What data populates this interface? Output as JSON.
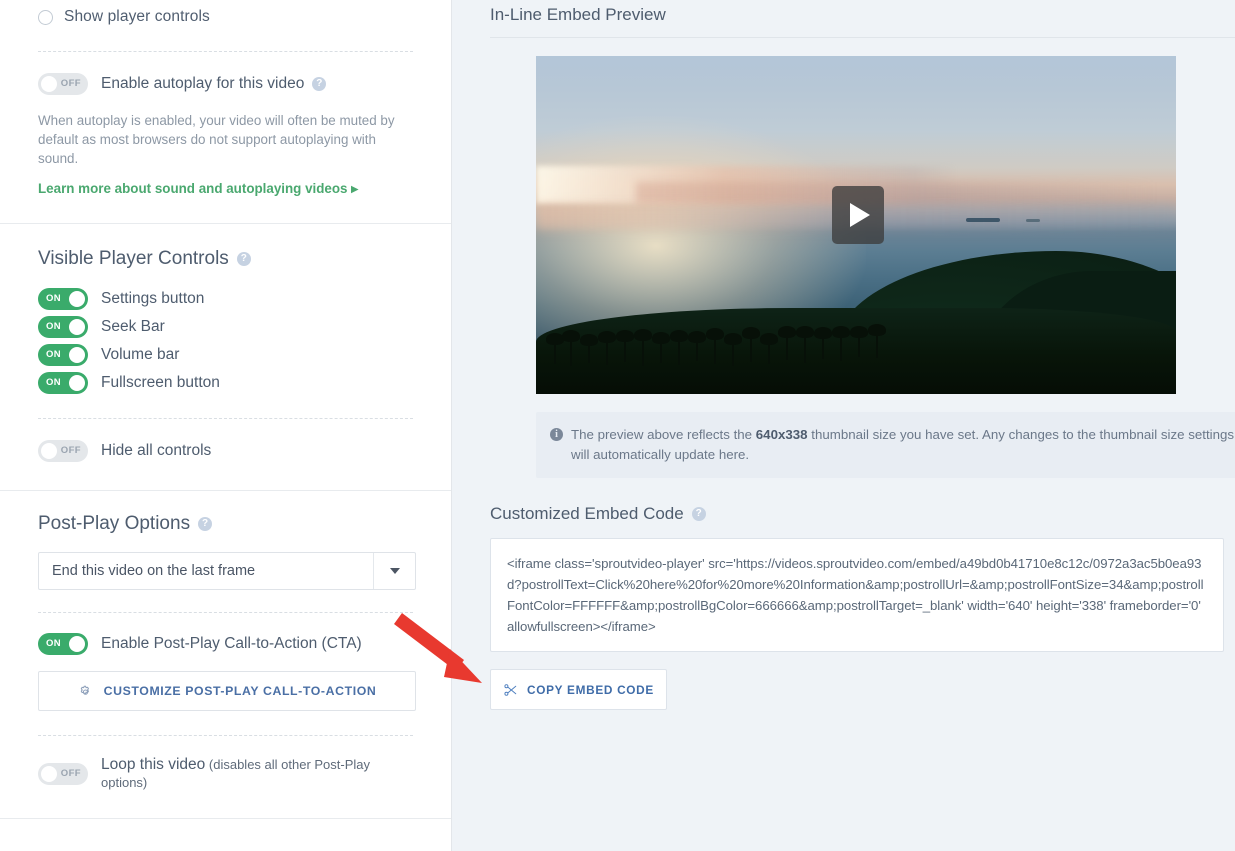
{
  "left_panel": {
    "show_player_controls": {
      "label": "Show player controls",
      "selected": false
    },
    "autoplay": {
      "toggle_state": "OFF",
      "label": "Enable autoplay for this video",
      "help_icon": "question-mark-icon",
      "description": "When autoplay is enabled, your video will often be muted by default as most browsers do not support autoplaying with sound.",
      "learn_more_link": "Learn more about sound and autoplaying videos ▸"
    },
    "visible_player_controls": {
      "title": "Visible Player Controls",
      "help_icon": "question-mark-icon",
      "toggles": [
        {
          "state": "ON",
          "label": "Settings button"
        },
        {
          "state": "ON",
          "label": "Seek Bar"
        },
        {
          "state": "ON",
          "label": "Volume bar"
        },
        {
          "state": "ON",
          "label": "Fullscreen button"
        }
      ],
      "hide_all": {
        "state": "OFF",
        "label": "Hide all controls"
      }
    },
    "post_play": {
      "title": "Post-Play Options",
      "help_icon": "question-mark-icon",
      "select_value": "End this video on the last frame",
      "cta_toggle": {
        "state": "ON",
        "label": "Enable Post-Play Call-to-Action (CTA)"
      },
      "customize_button": {
        "icon": "gear-icon",
        "label": "CUSTOMIZE POST-PLAY CALL-TO-ACTION"
      },
      "loop": {
        "state": "OFF",
        "label": "Loop this video",
        "sublabel": " (disables all other Post-Play options)"
      }
    }
  },
  "right_panel": {
    "preview_title": "In-Line Embed Preview",
    "video": {
      "play_icon": "play-button-icon",
      "alt": "tropical beach sunset thumbnail"
    },
    "notice": {
      "icon": "info-icon",
      "text_before": "The preview above reflects the ",
      "size": "640x338",
      "text_after": " thumbnail size you have set. Any changes to the thumbnail size settings will automatically update here."
    },
    "embed_section": {
      "title": "Customized Embed Code",
      "help_icon": "question-mark-icon",
      "code": "<iframe class='sproutvideo-player' src='https://videos.sproutvideo.com/embed/a49bd0b41710e8c12c/0972a3ac5b0ea93d?postrollText=Click%20here%20for%20more%20Information&amp;postrollUrl=&amp;postrollFontSize=34&amp;postrollFontColor=FFFFFF&amp;postrollBgColor=666666&amp;postrollTarget=_blank' width='640' height='338' frameborder='0' allowfullscreen></iframe>",
      "copy_button": {
        "icon": "scissors-icon",
        "label": "COPY EMBED CODE"
      }
    }
  },
  "annotation": {
    "arrow_color": "#e8392f",
    "points_to": "copy-embed-code-button"
  },
  "colors": {
    "toggle_on": "#3aab6b",
    "toggle_off": "#e4e7ea",
    "link_green": "#4aa86f",
    "button_blue": "#3f6ca8",
    "panel_bg": "#eff3f7",
    "text_primary": "#4e5c6e"
  }
}
